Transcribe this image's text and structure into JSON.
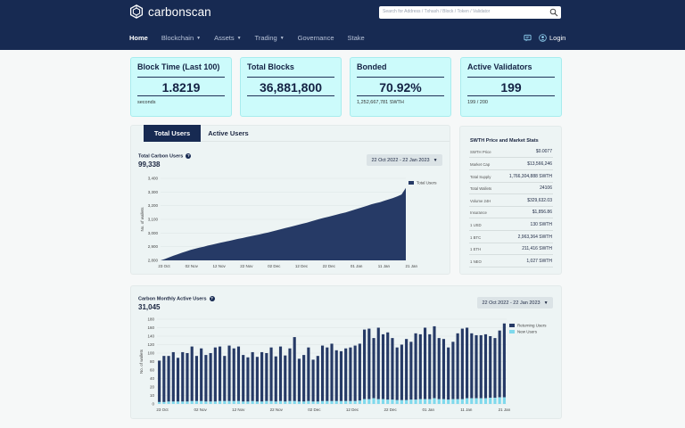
{
  "header": {
    "brand": "carbonscan",
    "search_placeholder": "Search for Address / Txhash / Block / Token / Validator",
    "nav": [
      {
        "label": "Home",
        "dropdown": false,
        "active": true
      },
      {
        "label": "Blockchain",
        "dropdown": true,
        "active": false
      },
      {
        "label": "Assets",
        "dropdown": true,
        "active": false
      },
      {
        "label": "Trading",
        "dropdown": true,
        "active": false
      },
      {
        "label": "Governance",
        "dropdown": false,
        "active": false
      },
      {
        "label": "Stake",
        "dropdown": false,
        "active": false
      }
    ],
    "login": "Login"
  },
  "cards": [
    {
      "title": "Block Time (Last 100)",
      "value": "1.8219",
      "sub": "seconds"
    },
    {
      "title": "Total Blocks",
      "value": "36,881,800",
      "sub": ""
    },
    {
      "title": "Bonded",
      "value": "70.92%",
      "sub": "1,252,667,781 SWTH"
    },
    {
      "title": "Active Validators",
      "value": "199",
      "sub": "199 / 200"
    }
  ],
  "tabs": {
    "total_users": "Total Users",
    "active_users": "Active Users"
  },
  "total_users_chart": {
    "title": "Total Carbon Users",
    "total": "99,338",
    "date_range": "22 Oct 2022 - 22 Jan 2023"
  },
  "monthly_chart": {
    "title": "Carbon Monthly Active Users",
    "total": "31,045",
    "date_range": "22 Oct 2022 - 22 Jan 2023"
  },
  "stats": {
    "title": "SWTH Price and Market Stats",
    "rows": [
      {
        "label": "SWTH Price",
        "value": "$0.0077"
      },
      {
        "label": "Market Cap",
        "value": "$13,566,246"
      },
      {
        "label": "Total Supply",
        "value": "1,766,304,888 SWTH"
      },
      {
        "label": "Total Wallets",
        "value": "24106"
      },
      {
        "label": "Volume 24H",
        "value": "$329,632.03"
      },
      {
        "label": "Insurance",
        "value": "$1,856.86"
      },
      {
        "label": "1 USD",
        "value": "130 SWTH"
      },
      {
        "label": "1 BTC",
        "value": "2,963,364 SWTH"
      },
      {
        "label": "1 ETH",
        "value": "211,416 SWTH"
      },
      {
        "label": "1 NEO",
        "value": "1,027 SWTH"
      }
    ]
  },
  "colors": {
    "navy": "#172a52",
    "cyan_card": "#ccfbfb",
    "new_users": "#7fd9ec"
  },
  "chart_data": [
    {
      "type": "area",
      "title": "Total Carbon Users",
      "ylabel": "No. of wallets",
      "ylim": [
        2800,
        3400
      ],
      "yticks": [
        "2,800",
        "2,900",
        "3,000",
        "3,100",
        "3,200",
        "3,300",
        "3,400"
      ],
      "xticks": [
        "23 Oct",
        "02 Nov",
        "12 Nov",
        "22 Nov",
        "02 Dec",
        "12 Dec",
        "22 Dec",
        "01 Jan",
        "11 Jan",
        "21 Jan"
      ],
      "legend": "top-right",
      "series": [
        {
          "name": "Total Users",
          "values": [
            2800,
            2810,
            2822,
            2834,
            2845,
            2856,
            2866,
            2876,
            2885,
            2893,
            2900,
            2908,
            2915,
            2922,
            2930,
            2936,
            2943,
            2950,
            2957,
            2963,
            2970,
            2977,
            2983,
            2990,
            2997,
            3004,
            3012,
            3020,
            3028,
            3036,
            3044,
            3052,
            3060,
            3068,
            3076,
            3085,
            3094,
            3103,
            3111,
            3119,
            3127,
            3135,
            3143,
            3151,
            3160,
            3170,
            3180,
            3190,
            3200,
            3210,
            3218,
            3226,
            3236,
            3246,
            3256,
            3268,
            3282,
            3330
          ]
        }
      ]
    },
    {
      "type": "bar",
      "title": "Carbon Monthly Active Users",
      "ylabel": "No. of wallets",
      "ylim": [
        0,
        180
      ],
      "yticks": [
        "0",
        "10",
        "20",
        "40",
        "60",
        "80",
        "100",
        "120",
        "140",
        "160",
        "180"
      ],
      "xticks": [
        "23 Oct",
        "02 Nov",
        "12 Nov",
        "22 Nov",
        "02 Dec",
        "12 Dec",
        "22 Dec",
        "01 Jan",
        "11 Jan",
        "21 Jan"
      ],
      "legend": "top-right",
      "series": [
        {
          "name": "Returning Users",
          "values": [
            92,
            102,
            102,
            110,
            98,
            110,
            108,
            122,
            102,
            118,
            104,
            108,
            120,
            122,
            102,
            124,
            118,
            122,
            104,
            99,
            110,
            100,
            110,
            108,
            120,
            101,
            122,
            103,
            118,
            142,
            96,
            104,
            120,
            94,
            102,
            124,
            120,
            128,
            114,
            112,
            118,
            120,
            124,
            128,
            158,
            160,
            140,
            162,
            148,
            152,
            140,
            120,
            126,
            138,
            132,
            150,
            148,
            162,
            148,
            165,
            140,
            138,
            120,
            132,
            150,
            160,
            162,
            150,
            146,
            146,
            148,
            144,
            140,
            156,
            171
          ]
        },
        {
          "name": "New Users",
          "values": [
            4,
            4,
            5,
            5,
            5,
            5,
            5,
            6,
            6,
            6,
            5,
            5,
            5,
            6,
            6,
            6,
            6,
            6,
            5,
            5,
            6,
            5,
            5,
            6,
            6,
            5,
            6,
            5,
            6,
            6,
            5,
            5,
            6,
            5,
            5,
            6,
            6,
            6,
            6,
            6,
            6,
            6,
            6,
            7,
            10,
            10,
            12,
            10,
            10,
            9,
            9,
            8,
            8,
            8,
            9,
            9,
            10,
            10,
            10,
            12,
            10,
            10,
            9,
            10,
            10,
            10,
            12,
            12,
            12,
            12,
            12,
            13,
            13,
            14,
            14
          ]
        }
      ]
    }
  ]
}
